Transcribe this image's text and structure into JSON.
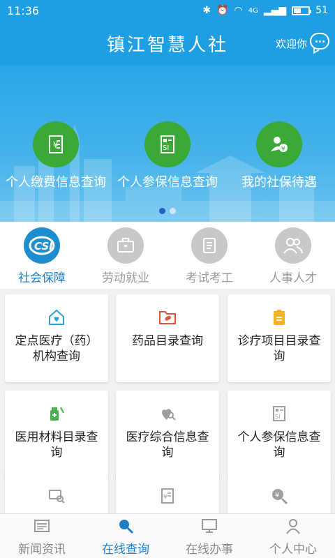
{
  "status_bar": {
    "time": "11:36",
    "network": "4G",
    "battery": "51",
    "battery_level": 0.51
  },
  "header": {
    "title": "镇江智慧人社",
    "welcome": "欢迎你"
  },
  "banner": {
    "items": [
      {
        "label": "个人缴费信息查询",
        "icon": "payment-receipt-icon"
      },
      {
        "label": "个人参保信息查询",
        "icon": "si-card-icon"
      },
      {
        "label": "我的社保待遇",
        "icon": "person-yen-icon"
      }
    ],
    "page_count": 2,
    "active_page": 1
  },
  "categories": [
    {
      "label": "社会保障",
      "icon": "csi-logo-icon",
      "active": true
    },
    {
      "label": "劳动就业",
      "icon": "briefcase-icon",
      "active": false
    },
    {
      "label": "考试考工",
      "icon": "scroll-icon",
      "active": false
    },
    {
      "label": "人事人才",
      "icon": "people-icon",
      "active": false
    }
  ],
  "grid": [
    {
      "label": "定点医疗（药）机构查询",
      "icon": "medical-house-icon",
      "color": "#2aa3d8"
    },
    {
      "label": "药品目录查询",
      "icon": "pill-folder-icon",
      "color": "#e8523a"
    },
    {
      "label": "诊疗项目目录查询",
      "icon": "clipboard-icon",
      "color": "#f5b324"
    },
    {
      "label": "医用材料目录查询",
      "icon": "medicine-bottle-icon",
      "color": "#4caf50"
    },
    {
      "label": "医疗综合信息查询",
      "icon": "heart-search-icon",
      "color": "#9e9e9e"
    },
    {
      "label": "个人参保信息查询",
      "icon": "si-card-icon",
      "color": "#9e9e9e"
    },
    {
      "label": "",
      "icon": "certificate-search-icon",
      "color": "#9e9e9e"
    },
    {
      "label": "",
      "icon": "yen-document-icon",
      "color": "#9e9e9e"
    },
    {
      "label": "",
      "icon": "yen-search-icon",
      "color": "#9e9e9e"
    }
  ],
  "bottom_nav": [
    {
      "label": "新闻资讯",
      "icon": "news-icon",
      "active": false
    },
    {
      "label": "在线查询",
      "icon": "search-icon",
      "active": true
    },
    {
      "label": "在线办事",
      "icon": "monitor-icon",
      "active": false
    },
    {
      "label": "个人中心",
      "icon": "user-icon",
      "active": false
    }
  ],
  "colors": {
    "primary": "#1e9fe3",
    "accent": "#1e7fc8",
    "banner_circle": "#3ba935"
  }
}
